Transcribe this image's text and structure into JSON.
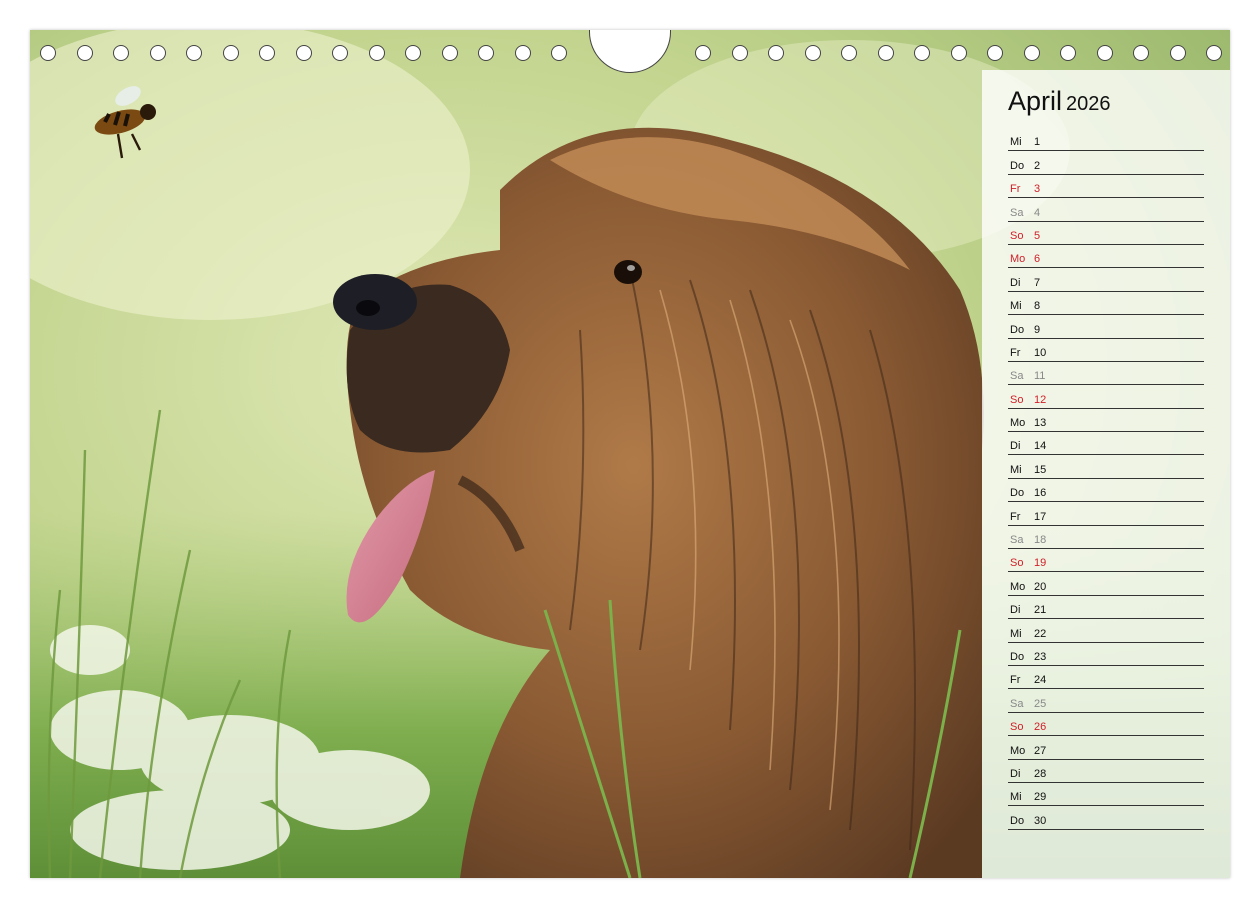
{
  "calendar": {
    "month": "April",
    "year": "2026",
    "days": [
      {
        "wd": "Mi",
        "d": "1",
        "type": "normal"
      },
      {
        "wd": "Do",
        "d": "2",
        "type": "normal"
      },
      {
        "wd": "Fr",
        "d": "3",
        "type": "red"
      },
      {
        "wd": "Sa",
        "d": "4",
        "type": "sat"
      },
      {
        "wd": "So",
        "d": "5",
        "type": "red"
      },
      {
        "wd": "Mo",
        "d": "6",
        "type": "red"
      },
      {
        "wd": "Di",
        "d": "7",
        "type": "normal"
      },
      {
        "wd": "Mi",
        "d": "8",
        "type": "normal"
      },
      {
        "wd": "Do",
        "d": "9",
        "type": "normal"
      },
      {
        "wd": "Fr",
        "d": "10",
        "type": "normal"
      },
      {
        "wd": "Sa",
        "d": "11",
        "type": "sat"
      },
      {
        "wd": "So",
        "d": "12",
        "type": "red"
      },
      {
        "wd": "Mo",
        "d": "13",
        "type": "normal"
      },
      {
        "wd": "Di",
        "d": "14",
        "type": "normal"
      },
      {
        "wd": "Mi",
        "d": "15",
        "type": "normal"
      },
      {
        "wd": "Do",
        "d": "16",
        "type": "normal"
      },
      {
        "wd": "Fr",
        "d": "17",
        "type": "normal"
      },
      {
        "wd": "Sa",
        "d": "18",
        "type": "sat"
      },
      {
        "wd": "So",
        "d": "19",
        "type": "red"
      },
      {
        "wd": "Mo",
        "d": "20",
        "type": "normal"
      },
      {
        "wd": "Di",
        "d": "21",
        "type": "normal"
      },
      {
        "wd": "Mi",
        "d": "22",
        "type": "normal"
      },
      {
        "wd": "Do",
        "d": "23",
        "type": "normal"
      },
      {
        "wd": "Fr",
        "d": "24",
        "type": "normal"
      },
      {
        "wd": "Sa",
        "d": "25",
        "type": "sat"
      },
      {
        "wd": "So",
        "d": "26",
        "type": "red"
      },
      {
        "wd": "Mo",
        "d": "27",
        "type": "normal"
      },
      {
        "wd": "Di",
        "d": "28",
        "type": "normal"
      },
      {
        "wd": "Mi",
        "d": "29",
        "type": "normal"
      },
      {
        "wd": "Do",
        "d": "30",
        "type": "normal"
      }
    ]
  },
  "colors": {
    "holiday_red": "#d0202a",
    "saturday_gray": "#888888",
    "text": "#111111"
  },
  "photo": {
    "subject_icons": [
      "dog-illustration",
      "bee-icon",
      "grass-illustration"
    ]
  }
}
